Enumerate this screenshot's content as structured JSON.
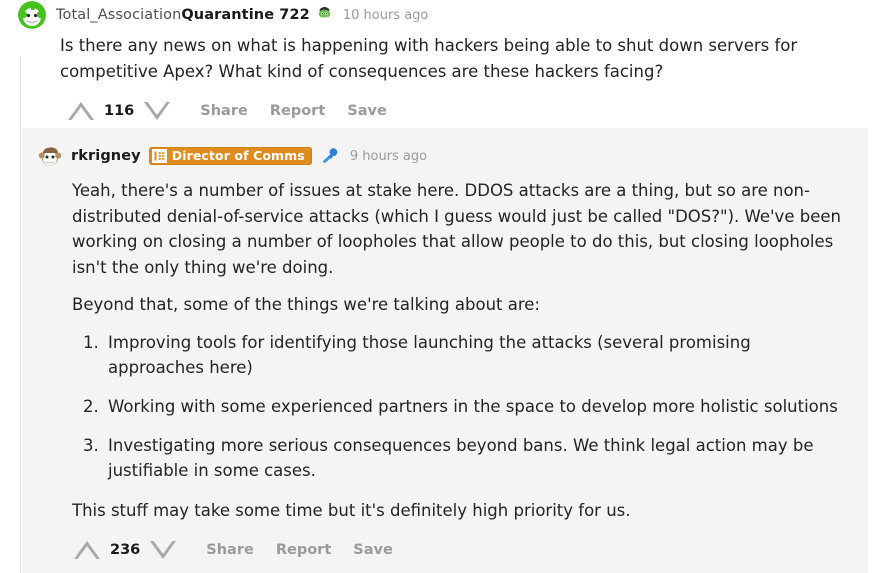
{
  "thread": {
    "top_comment": {
      "avatar_name": "snoo-avatar-green",
      "username_plain": "Total_Association",
      "username_bold": "Quarantine 722",
      "user_badge_icon": "snoo-flair-icon",
      "timestamp": "10 hours ago",
      "body": "Is there any news on what is happening with hackers being able to shut down servers for competitive Apex? What kind of consequences are these hackers facing?",
      "score": "116",
      "upvote_icon": "upvote-arrow-icon",
      "downvote_icon": "downvote-arrow-icon",
      "actions": [
        "Share",
        "Report",
        "Save"
      ]
    },
    "reply": {
      "avatar_name": "snoo-avatar-tan",
      "username": "rkrigney",
      "flair": {
        "icon": "list-dots-icon",
        "label": "Director of Comms",
        "bg_color": "#e08b1e",
        "text_color": "#ffffff"
      },
      "verified_icon": "microphone-icon",
      "timestamp": "9 hours ago",
      "paragraph_1": "Yeah, there's a number of issues at stake here. DDOS attacks are a thing, but so are non-distributed denial-of-service attacks (which I guess would just be called \"DOS?\"). We've been working on closing a number of loopholes that allow people to do this, but closing loopholes isn't the only thing we're doing.",
      "paragraph_2": "Beyond that, some of the things we're talking about are:",
      "list_items": [
        "Improving tools for identifying those launching the attacks (several promising approaches here)",
        "Working with some experienced partners in the space to develop more holistic solutions",
        "Investigating more serious consequences beyond bans. We think legal action may be justifiable in some cases."
      ],
      "paragraph_3": "This stuff may take some time but it's definitely high priority for us.",
      "score": "236",
      "upvote_icon": "upvote-arrow-icon",
      "downvote_icon": "downvote-arrow-icon",
      "actions": [
        "Share",
        "Report",
        "Save"
      ]
    }
  },
  "colors": {
    "page_bg": "#ffffff",
    "highlight_bg": "#f4f4f4",
    "text": "#222326",
    "muted": "#9a9a9c",
    "thread_line": "#e3e3e3",
    "flair_orange": "#e08b1e",
    "mic_blue": "#2b7dd6"
  }
}
